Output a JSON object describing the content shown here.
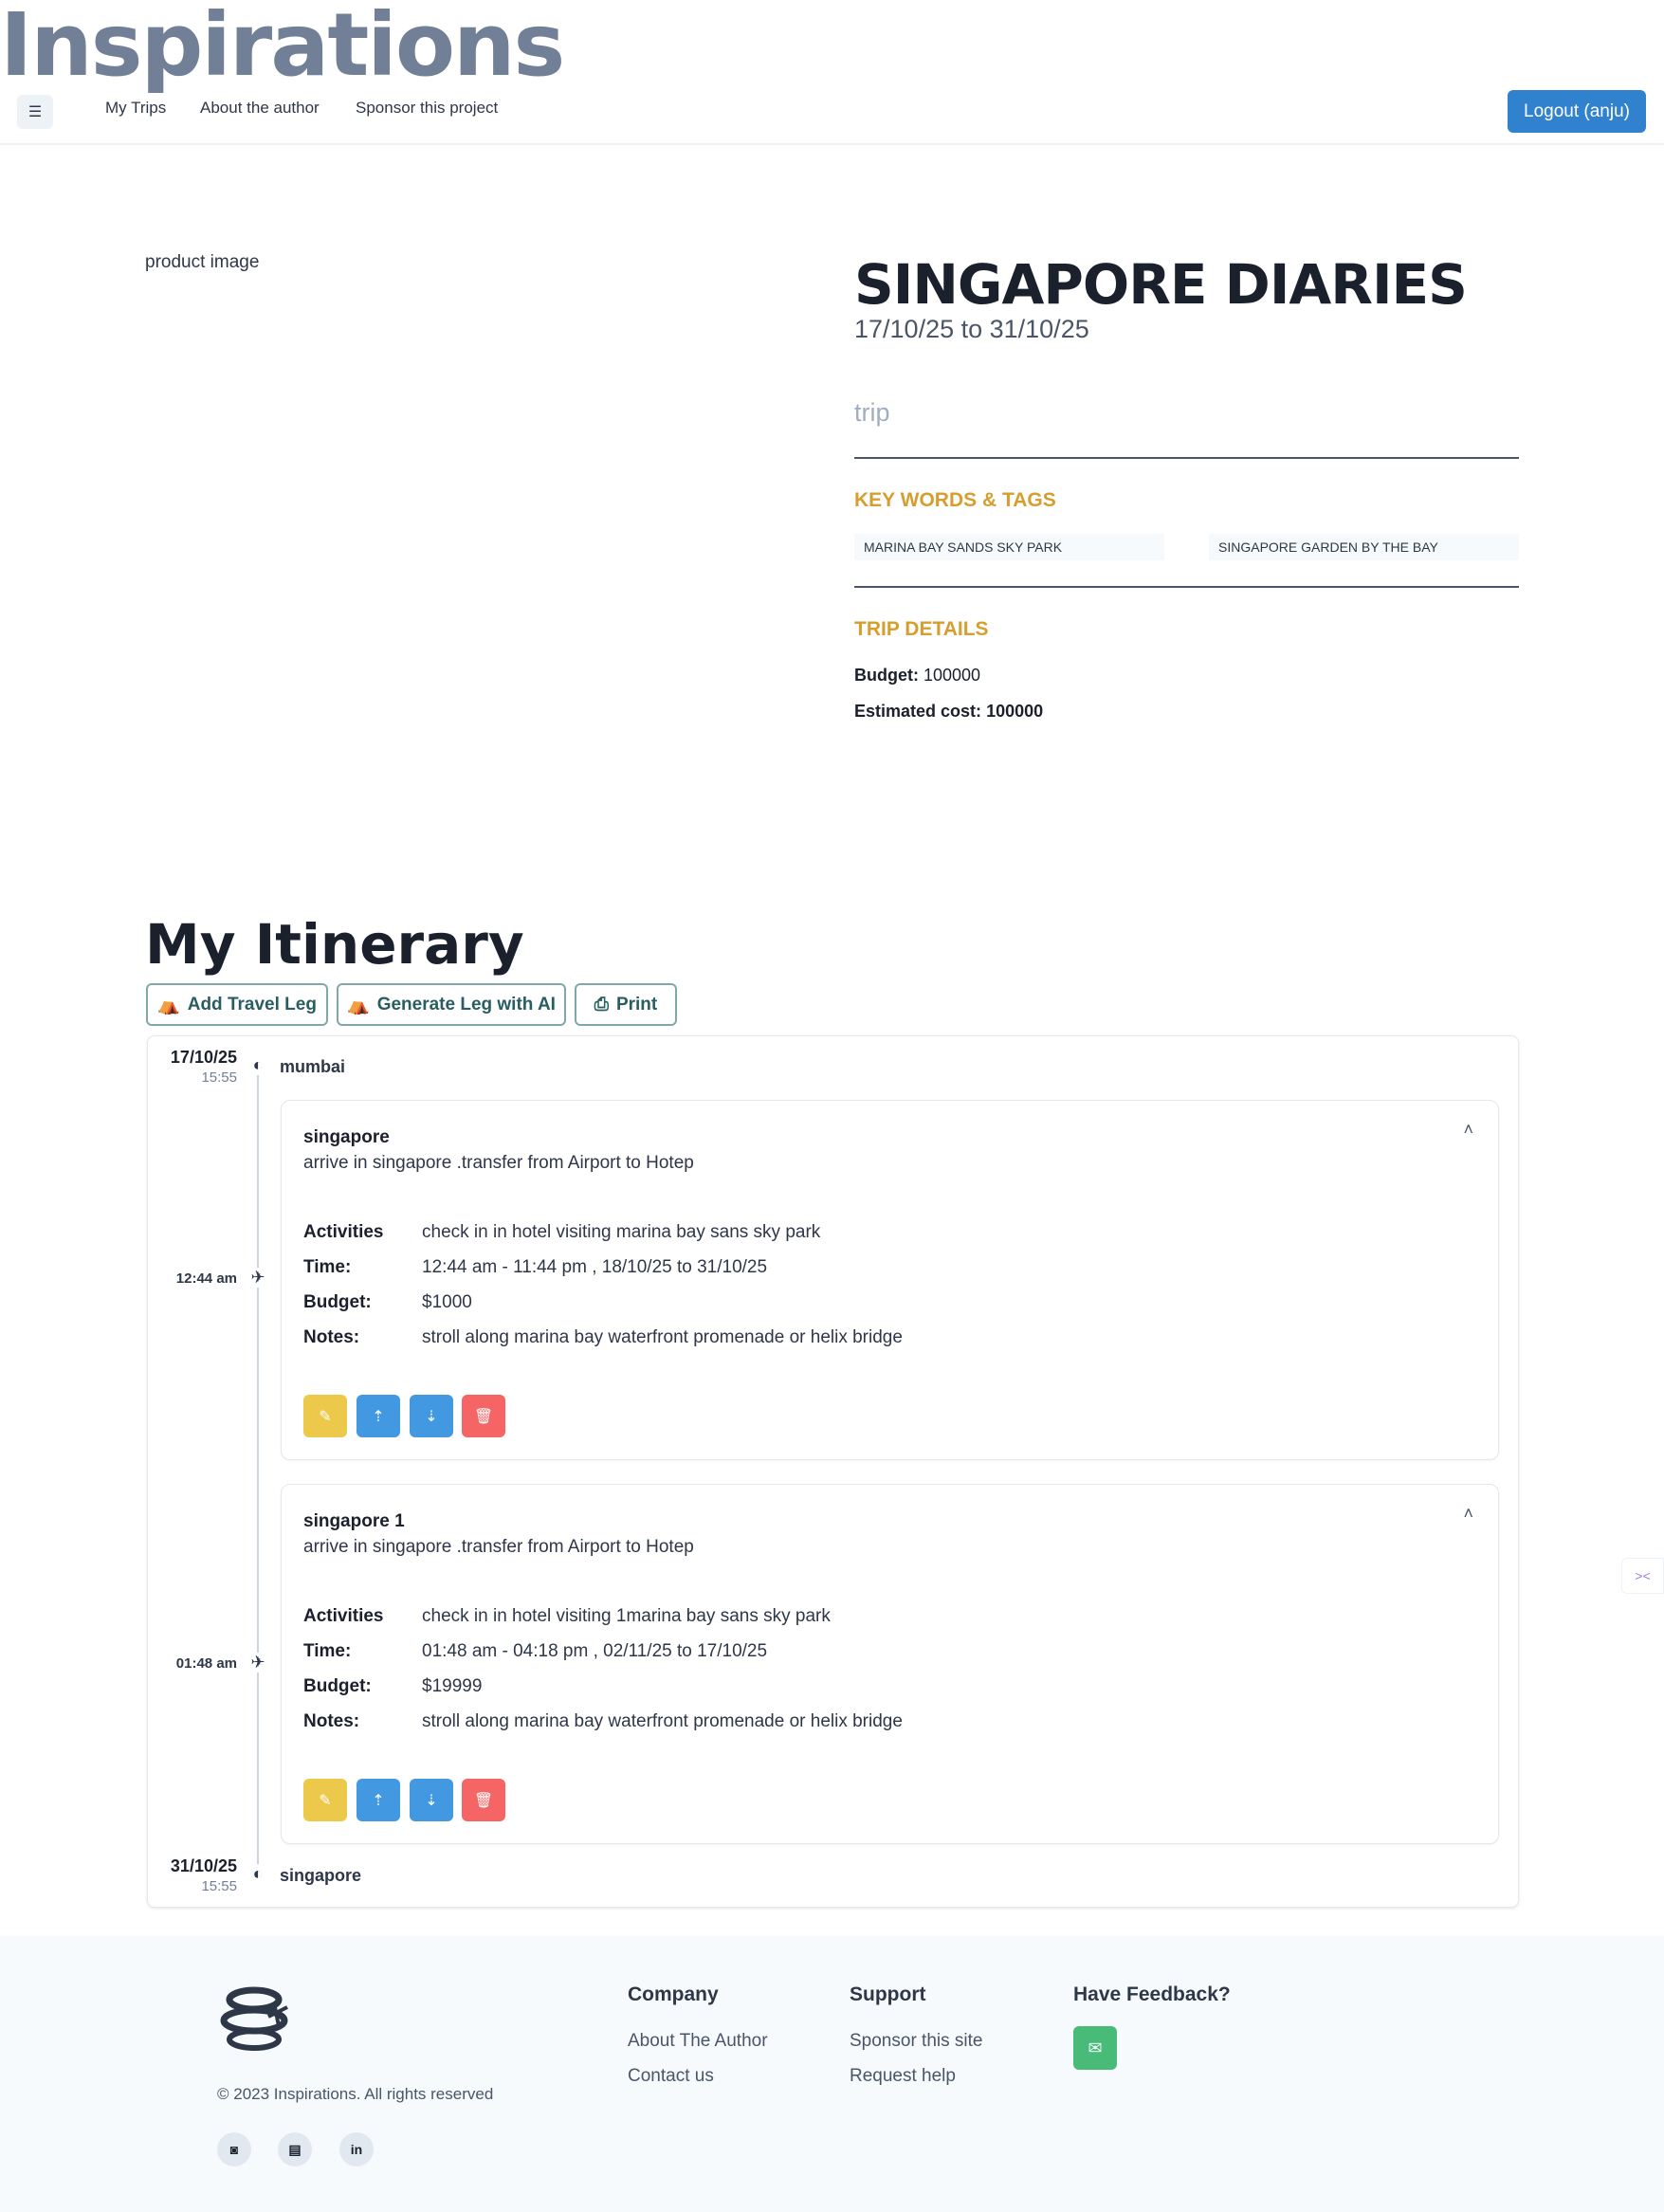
{
  "header": {
    "brand": "Inspirations",
    "nav": [
      "My Trips",
      "About the author",
      "Sponsor this project"
    ],
    "logout": "Logout (anju)"
  },
  "trip": {
    "image_alt": "product image",
    "title": "SINGAPORE DIARIES",
    "dates": "17/10/25 to 31/10/25",
    "type": "trip",
    "keywords_heading": "KEY WORDS & TAGS",
    "tags": [
      "MARINA BAY SANDS SKY PARK",
      "SINGAPORE GARDEN BY THE BAY"
    ],
    "details_heading": "TRIP DETAILS",
    "budget_label": "Budget:",
    "budget": "100000",
    "estimated_label": "Estimated cost:",
    "estimated": "100000"
  },
  "itinerary": {
    "heading": "My Itinerary",
    "buttons": [
      "Add Travel Leg",
      "Generate Leg with AI",
      "Print"
    ],
    "start": {
      "date": "17/10/25",
      "time": "15:55",
      "place": "mumbai"
    },
    "end": {
      "date": "31/10/25",
      "time": "15:55",
      "place": "singapore"
    },
    "labels": {
      "activities": "Activities",
      "time": "Time:",
      "budget": "Budget:",
      "notes": "Notes:"
    },
    "legs": [
      {
        "marker_time": "12:44 am",
        "title": "singapore",
        "subtitle": "arrive in singapore .transfer from Airport to Hotep",
        "activities": "check in in hotel visiting marina bay sans sky park",
        "time": "12:44 am - 11:44 pm , 18/10/25 to 31/10/25",
        "budget": "$1000",
        "notes": "stroll along marina bay waterfront promenade or helix bridge"
      },
      {
        "marker_time": "01:48 am",
        "title": "singapore 1",
        "subtitle": "arrive in singapore .transfer from Airport to Hotep",
        "activities": "check in in hotel visiting 1marina bay sans sky park",
        "time": "01:48 am - 04:18 pm , 02/11/25 to 17/10/25",
        "budget": "$19999",
        "notes": "stroll along marina bay waterfront promenade or helix bridge"
      }
    ]
  },
  "footer": {
    "copyright": "© 2023 Inspirations. All rights reserved",
    "company_heading": "Company",
    "company_links": [
      "About The Author",
      "Contact us"
    ],
    "support_heading": "Support",
    "support_links": [
      "Sponsor this site",
      "Request help"
    ],
    "feedback_heading": "Have Feedback?"
  },
  "colors": {
    "accent": "#3182ce",
    "gold": "#d69e2e",
    "edit": "#ecc94b",
    "move": "#4299e1",
    "delete": "#f56565",
    "feedback": "#48bb78"
  }
}
